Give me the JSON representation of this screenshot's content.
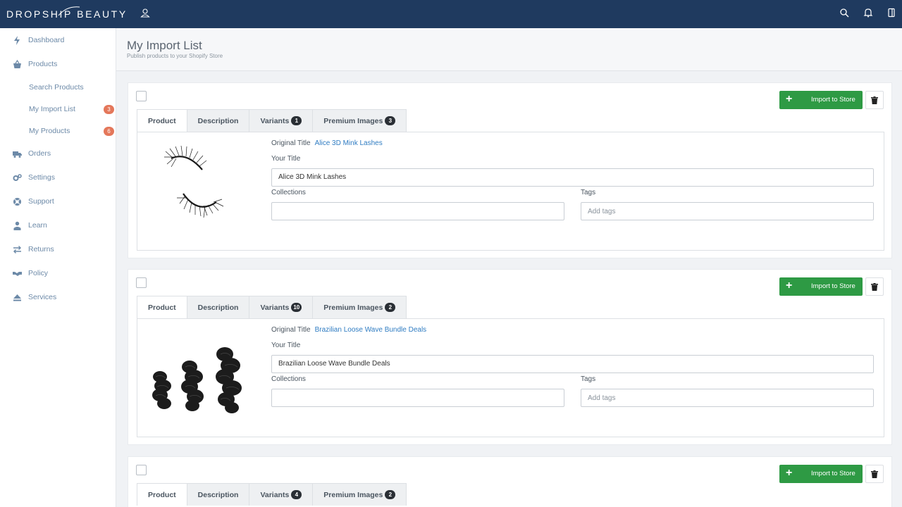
{
  "app": {
    "logo_text": "DROPSHIP BEAUTY"
  },
  "sidebar": {
    "items": [
      {
        "label": "Dashboard"
      },
      {
        "label": "Products"
      },
      {
        "label": "Search Products"
      },
      {
        "label": "My Import List",
        "badge": "3"
      },
      {
        "label": "My Products",
        "badge": "6"
      },
      {
        "label": "Orders"
      },
      {
        "label": "Settings"
      },
      {
        "label": "Support"
      },
      {
        "label": "Learn"
      },
      {
        "label": "Returns"
      },
      {
        "label": "Policy"
      },
      {
        "label": "Services"
      }
    ]
  },
  "header": {
    "title": "My Import List",
    "subtitle": "Publish products to your Shopify Store"
  },
  "labels": {
    "import_button": "Import to Store",
    "tab_product": "Product",
    "tab_description": "Description",
    "tab_variants": "Variants",
    "tab_premium_images": "Premium Images",
    "original_title": "Original Title",
    "your_title": "Your Title",
    "collections": "Collections",
    "tags": "Tags",
    "tags_placeholder": "Add tags"
  },
  "products": [
    {
      "original_title": "Alice 3D Mink Lashes",
      "your_title": "Alice 3D Mink Lashes",
      "variants_count": "1",
      "premium_images_count": "3",
      "collections": ""
    },
    {
      "original_title": "Brazilian Loose Wave Bundle Deals",
      "your_title": "Brazilian Loose Wave Bundle Deals",
      "variants_count": "10",
      "premium_images_count": "2",
      "collections": ""
    },
    {
      "variants_count": "4",
      "premium_images_count": "2"
    }
  ],
  "colors": {
    "topbar": "#1f3a5f",
    "import_button": "#2e9a44",
    "badge": "#e4775a",
    "link": "#2f7cc2",
    "sidebar_text": "#6d8aa8"
  }
}
